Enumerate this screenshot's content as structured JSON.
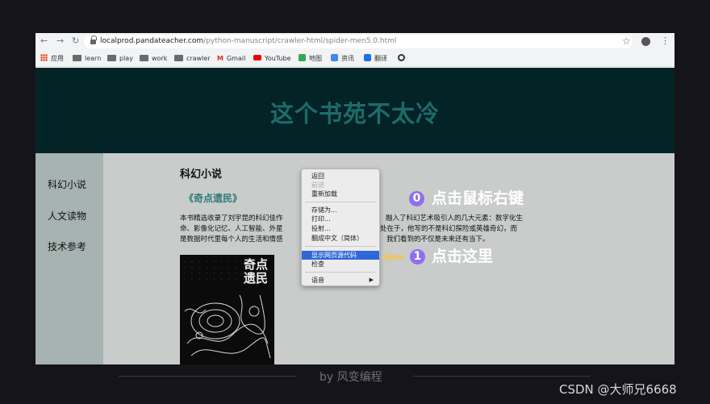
{
  "browser": {
    "url_host": "localprod.pandateacher.com",
    "url_path": "/python-manuscript/crawler-html/spider-men5.0.html",
    "bookmarks": [
      {
        "label": "应用",
        "icon": "apps-grid-icon"
      },
      {
        "label": "learn",
        "icon": "folder-icon"
      },
      {
        "label": "play",
        "icon": "folder-icon"
      },
      {
        "label": "work",
        "icon": "folder-icon"
      },
      {
        "label": "crawler",
        "icon": "folder-icon"
      },
      {
        "label": "Gmail",
        "icon": "gmail-icon"
      },
      {
        "label": "YouTube",
        "icon": "youtube-icon"
      },
      {
        "label": "地图",
        "icon": "maps-icon"
      },
      {
        "label": "资讯",
        "icon": "news-icon"
      },
      {
        "label": "翻译",
        "icon": "translate-icon"
      }
    ]
  },
  "site": {
    "title": "这个书苑不太冷",
    "sidebar": [
      "科幻小说",
      "人文读物",
      "技术参考"
    ],
    "section_title": "科幻小说",
    "book_title": "《奇点遗民》",
    "description": [
      "本书精选收录了刘宇昆的科幻佳作",
      "融入了科幻艺术吸引人的几大元素：数字化生",
      "命、影像化记忆、人工智能、外星",
      "处在于，他写的不是科幻探险或英雄奇幻，而",
      "是数据时代里每个人的生活和情感",
      "我们看到的不仅是未来还有当下。"
    ],
    "cover_title": "奇点遗民"
  },
  "context_menu": {
    "items": [
      "返回",
      "前进",
      "重新加载",
      "存储为...",
      "打印...",
      "投射...",
      "翻成中文（简体）",
      "显示网页源代码",
      "检查",
      "语音"
    ]
  },
  "annotations": {
    "step0_number": "0",
    "step0_text": "点击鼠标右键",
    "step1_number": "1",
    "step1_text": "点击这里"
  },
  "footer": {
    "byline": "by 风变编程",
    "watermark": "CSDN @大师兄6668"
  },
  "colors": {
    "header_bg": "#032326",
    "title_color": "#1e6b6a",
    "badge": "#8f6ff0",
    "menu_highlight": "#2f67d6"
  }
}
